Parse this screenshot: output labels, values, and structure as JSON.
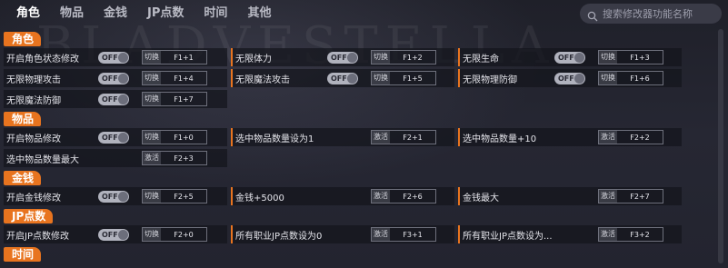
{
  "tabs": [
    "角色",
    "物品",
    "金钱",
    "JP点数",
    "时间",
    "其他"
  ],
  "search": {
    "placeholder": "搜索修改器功能名称"
  },
  "bg_text": "BLADVESTELLA",
  "toggle_off": "OFF",
  "sections": {
    "role": {
      "title": "角色",
      "rows": [
        [
          {
            "label": "开启角色状态修改",
            "toggle": "OFF",
            "action": "切换",
            "key": "F1+1"
          },
          {
            "label": "无限体力",
            "toggle": "OFF",
            "action": "切换",
            "key": "F1+2"
          },
          {
            "label": "无限生命",
            "toggle": "OFF",
            "action": "切换",
            "key": "F1+3"
          }
        ],
        [
          {
            "label": "无限物理攻击",
            "toggle": "OFF",
            "action": "切换",
            "key": "F1+4"
          },
          {
            "label": "无限魔法攻击",
            "toggle": "OFF",
            "action": "切换",
            "key": "F1+5"
          },
          {
            "label": "无限物理防御",
            "toggle": "OFF",
            "action": "切换",
            "key": "F1+6"
          }
        ],
        [
          {
            "label": "无限魔法防御",
            "toggle": "OFF",
            "action": "切换",
            "key": "F1+7"
          }
        ]
      ]
    },
    "items": {
      "title": "物品",
      "rows": [
        [
          {
            "label": "开启物品修改",
            "toggle": "OFF",
            "action": "切换",
            "key": "F1+0"
          },
          {
            "label": "选中物品数量设为1",
            "action": "激活",
            "key": "F2+1"
          },
          {
            "label": "选中物品数量+10",
            "action": "激活",
            "key": "F2+2"
          }
        ],
        [
          {
            "label": "选中物品数量最大",
            "action": "激活",
            "key": "F2+3"
          }
        ]
      ]
    },
    "money": {
      "title": "金钱",
      "rows": [
        [
          {
            "label": "开启金钱修改",
            "toggle": "OFF",
            "action": "切换",
            "key": "F2+5"
          },
          {
            "label": "金钱+5000",
            "action": "激活",
            "key": "F2+6"
          },
          {
            "label": "金钱最大",
            "action": "激活",
            "key": "F2+7"
          }
        ]
      ]
    },
    "jp": {
      "title": "JP点数",
      "rows": [
        [
          {
            "label": "开启JP点数修改",
            "toggle": "OFF",
            "action": "切换",
            "key": "F2+0"
          },
          {
            "label": "所有职业JP点数设为0",
            "action": "激活",
            "key": "F3+1"
          },
          {
            "label": "所有职业JP点数设为...",
            "action": "激活",
            "key": "F3+2"
          }
        ]
      ]
    },
    "time": {
      "title": "时间"
    }
  },
  "colors": {
    "accent": "#e8741f",
    "background": "#23242f"
  }
}
